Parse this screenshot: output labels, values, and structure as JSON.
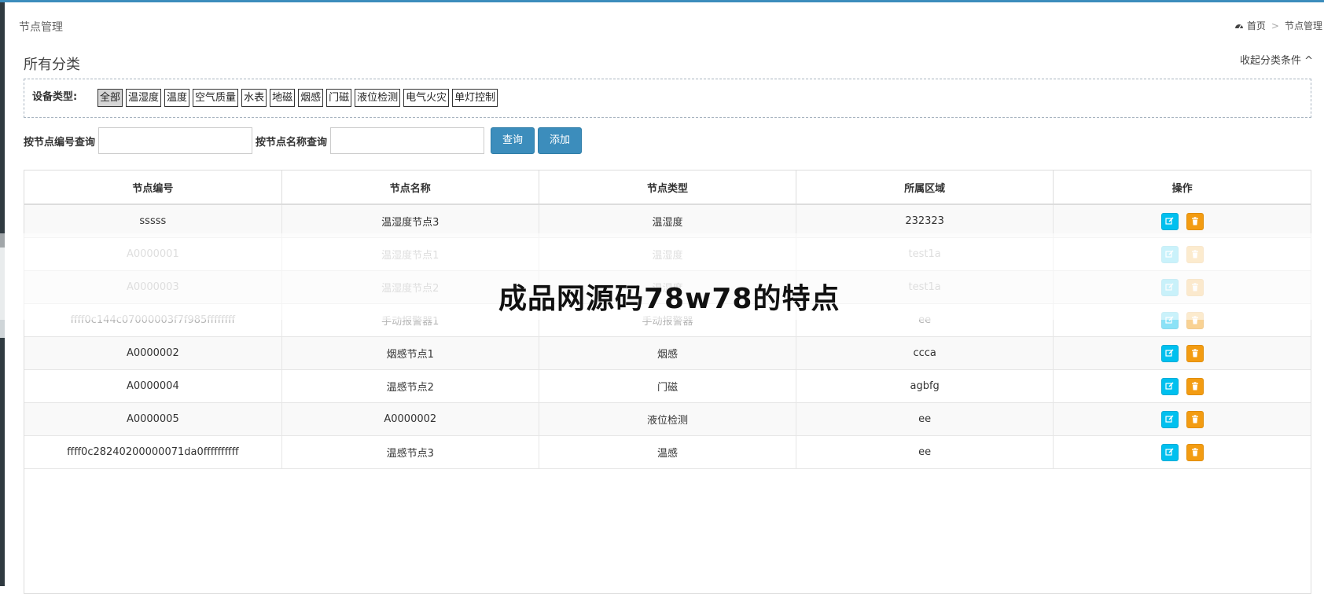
{
  "page": {
    "header_title": "节点管理",
    "breadcrumb": {
      "home": "首页",
      "separator": ">",
      "current": "节点管理"
    },
    "section_title": "所有分类",
    "collapse_label": "收起分类条件 ^"
  },
  "filter": {
    "label": "设备类型:",
    "types": [
      "全部",
      "温湿度",
      "温度",
      "空气质量",
      "水表",
      "地磁",
      "烟感",
      "门磁",
      "液位检测",
      "电气火灾",
      "单灯控制"
    ],
    "active_index": 0
  },
  "search": {
    "code_label": "按节点编号查询",
    "code_value": "",
    "name_label": "按节点名称查询",
    "name_value": "",
    "query_button": "查询",
    "add_button": "添加"
  },
  "table": {
    "columns": [
      "节点编号",
      "节点名称",
      "节点类型",
      "所属区域",
      "操作"
    ],
    "rows": [
      {
        "code": "sssss",
        "name": "温湿度节点3",
        "type": "温湿度",
        "area": "232323",
        "faded": false
      },
      {
        "code": "A0000001",
        "name": "温湿度节点1",
        "type": "温湿度",
        "area": "test1a",
        "faded": true
      },
      {
        "code": "A0000003",
        "name": "温湿度节点2",
        "type": "温湿度",
        "area": "test1a",
        "faded": true
      },
      {
        "code": "ffff0c144c07000003f7f985ffffffff",
        "name": "手动报警器1",
        "type": "手动报警器",
        "area": "ee",
        "faded": true
      },
      {
        "code": "A0000002",
        "name": "烟感节点1",
        "type": "烟感",
        "area": "ccca",
        "faded": false
      },
      {
        "code": "A0000004",
        "name": "温感节点2",
        "type": "门磁",
        "area": "agbfg",
        "faded": false
      },
      {
        "code": "A0000005",
        "name": "A0000002",
        "type": "液位检测",
        "area": "ee",
        "faded": false
      },
      {
        "code": "ffff0c28240200000071da0ffffffffff",
        "name": "温感节点3",
        "type": "温感",
        "area": "ee",
        "faded": false
      }
    ]
  },
  "icons": {
    "home": "dashboard-icon",
    "edit": "edit-icon",
    "delete": "trash-icon"
  },
  "colors": {
    "primary": "#3c8dbc",
    "edit": "#00c0ef",
    "delete": "#f39c12"
  },
  "watermark": "成品网源码78w78的特点"
}
